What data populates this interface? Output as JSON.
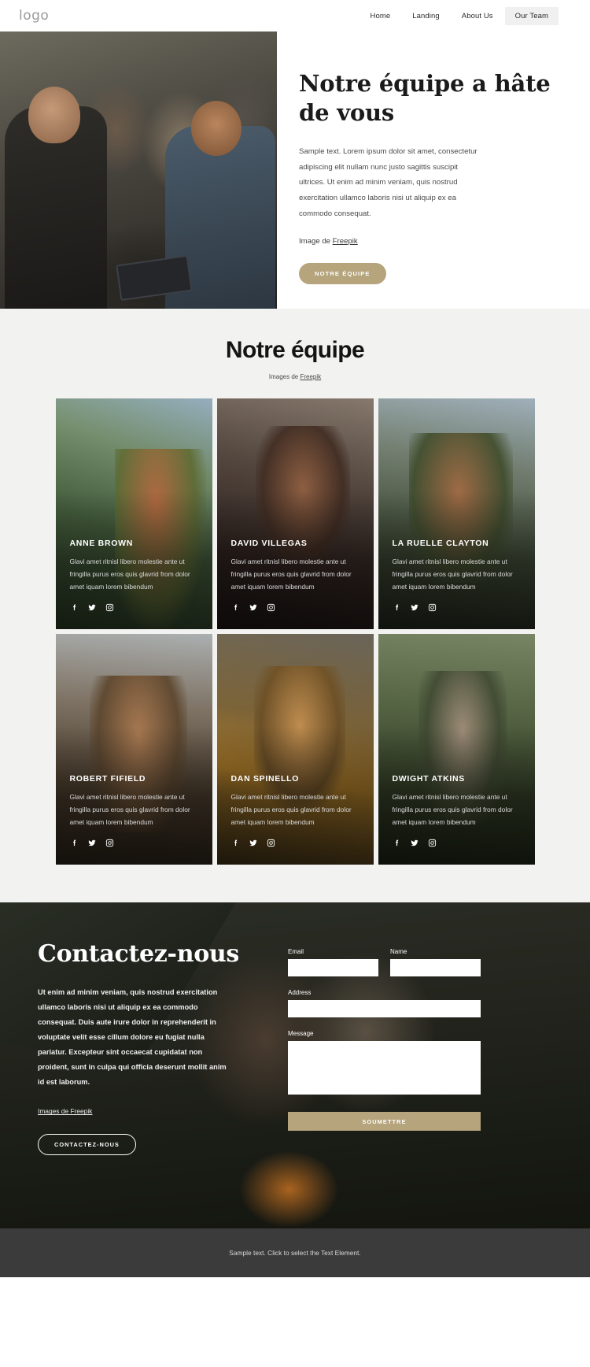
{
  "header": {
    "logo": "logo",
    "nav": [
      {
        "label": "Home",
        "active": false
      },
      {
        "label": "Landing",
        "active": false
      },
      {
        "label": "About Us",
        "active": false
      },
      {
        "label": "Our Team",
        "active": true
      }
    ]
  },
  "hero": {
    "title": "Notre équipe a hâte de vous",
    "paragraph": "Sample text. Lorem ipsum dolor sit amet, consectetur adipiscing elit nullam nunc justo sagittis suscipit ultrices. Ut enim ad minim veniam, quis nostrud exercitation ullamco laboris nisi ut aliquip ex ea commodo consequat.",
    "credit_prefix": "Image de ",
    "credit_link": "Freepik",
    "cta": "NOTRE ÉQUIPE"
  },
  "team": {
    "title": "Notre équipe",
    "credit_prefix": "Images de ",
    "credit_link": "Freepik",
    "members": [
      {
        "name": "ANNE BROWN",
        "desc": "Glavi amet ritnisl libero molestie ante ut fringilla purus eros quis glavrid from dolor amet iquam lorem bibendum",
        "socials": [
          "facebook-icon",
          "twitter-icon",
          "instagram-icon"
        ]
      },
      {
        "name": "DAVID VILLEGAS",
        "desc": "Glavi amet ritnisl libero molestie ante ut fringilla purus eros quis glavrid from dolor amet iquam lorem bibendum",
        "socials": [
          "facebook-icon",
          "twitter-icon",
          "instagram-icon"
        ]
      },
      {
        "name": "LA RUELLE CLAYTON",
        "desc": "Glavi amet ritnisl libero molestie ante ut fringilla purus eros quis glavrid from dolor amet iquam lorem bibendum",
        "socials": [
          "facebook-icon",
          "twitter-icon",
          "instagram-icon"
        ]
      },
      {
        "name": "ROBERT FIFIELD",
        "desc": "Glavi amet ritnisl libero molestie ante ut fringilla purus eros quis glavrid from dolor amet iquam lorem bibendum",
        "socials": [
          "facebook-icon",
          "twitter-icon",
          "instagram-icon"
        ]
      },
      {
        "name": "DAN SPINELLO",
        "desc": "Glavi amet ritnisl libero molestie ante ut fringilla purus eros quis glavrid from dolor amet iquam lorem bibendum",
        "socials": [
          "facebook-icon",
          "twitter-icon",
          "instagram-icon"
        ]
      },
      {
        "name": "DWIGHT ATKINS",
        "desc": "Glavi amet ritnisl libero molestie ante ut fringilla purus eros quis glavrid from dolor amet iquam lorem bibendum",
        "socials": [
          "facebook-icon",
          "twitter-icon",
          "instagram-icon"
        ]
      }
    ]
  },
  "contact": {
    "title": "Contactez-nous",
    "paragraph": "Ut enim ad minim veniam, quis nostrud exercitation ullamco laboris nisi ut aliquip ex ea commodo consequat. Duis aute irure dolor in reprehenderit in voluptate velit esse cillum dolore eu fugiat nulla pariatur. Excepteur sint occaecat cupidatat non proident, sunt in culpa qui officia deserunt mollit anim id est laborum.",
    "credit_prefix": "Images de ",
    "credit_link": "Freepik",
    "cta": "CONTACTEZ-NOUS",
    "form": {
      "email_label": "Email",
      "email_value": "",
      "name_label": "Name",
      "name_value": "",
      "address_label": "Address",
      "address_value": "",
      "message_label": "Message",
      "message_value": "",
      "submit_label": "SOUMETTRE"
    }
  },
  "footer": {
    "text": "Sample text. Click to select the Text Element."
  },
  "colors": {
    "accent": "#b5a47c",
    "team_bg": "#f2f2f0",
    "footer_bg": "#3b3b3b"
  }
}
